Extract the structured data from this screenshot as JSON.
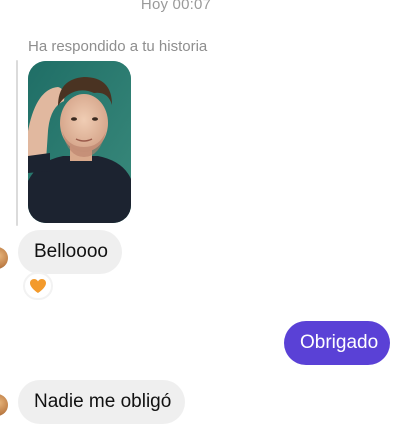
{
  "header": {
    "timestamp": "Hoy 00:07"
  },
  "story_reply": {
    "context_text": "Ha respondido a tu historia",
    "thumbnail": "story-photo"
  },
  "messages": [
    {
      "direction": "incoming",
      "text": "Belloooo",
      "reaction": "orange-heart"
    },
    {
      "direction": "outgoing",
      "text": "Obrigado"
    },
    {
      "direction": "incoming",
      "text": "Nadie me obligó"
    }
  ],
  "colors": {
    "outgoing_bubble": "#5a41d6",
    "incoming_bubble": "#efefef",
    "reaction_heart": "#f39a2b",
    "meta_text": "#8e8e8e"
  }
}
